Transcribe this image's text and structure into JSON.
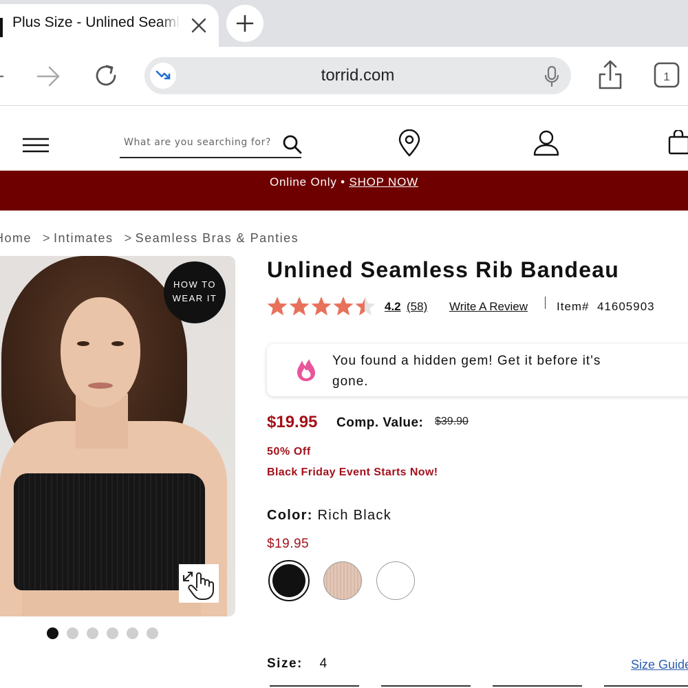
{
  "browser": {
    "tab_title": "Plus Size - Unlined Seamless Rib Bandeau",
    "url": "torrid.com"
  },
  "header": {
    "search_placeholder": "What are you searching for?"
  },
  "promo": {
    "text": "Online Only •",
    "link": "SHOP NOW"
  },
  "breadcrumb": [
    "Home",
    "Intimates",
    "Seamless Bras & Panties"
  ],
  "breadcrumb_separator": ">",
  "image": {
    "badge_line1": "HOW TO",
    "badge_line2": "WEAR IT",
    "dot_count": 6,
    "active_dot": 0
  },
  "product": {
    "title": "Unlined Seamless Rib Bandeau",
    "rating": "4.2",
    "rating_value": 4.2,
    "rating_max": 5,
    "review_count": "(58)",
    "write_review": "Write A Review",
    "item_number": "Item#  41605903",
    "gem_message": "You found a hidden gem! Get it before it's gone.",
    "sale_price": "$19.95",
    "comp_label": "Comp. Value:",
    "comp_price": "$39.90",
    "discount": "50% Off",
    "event": "Black Friday Event Starts Now!",
    "color_label": "Color:",
    "color_value": "Rich Black",
    "swatch_price": "$19.95",
    "size_label": "Size:",
    "size_value": "4",
    "size_guide": "Size Guide"
  },
  "colors": {
    "brand_banner": "#6f0000",
    "sale_red": "#a3111b",
    "star": "#e8715b",
    "link_blue": "#2a5db0"
  }
}
